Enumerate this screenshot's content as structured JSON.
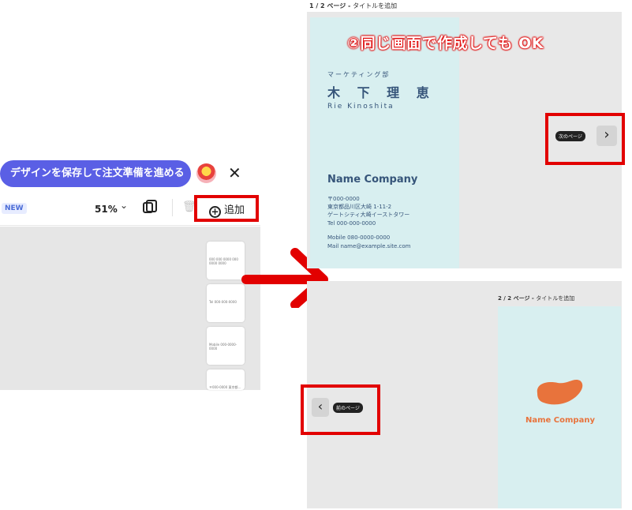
{
  "editor": {
    "save_button": "デザインを保存して注文準備を進める",
    "close": "✕",
    "new_badge": "NEW",
    "zoom": "51%",
    "zoom_chevron": "⌄",
    "trash": "🗑",
    "add_button": "追加",
    "add_icon": "+",
    "thumbs": [
      "000 000 0000 000 0000 0000",
      "Tel 000-000-0000",
      "Mobile 000-0000-0000",
      "〒000-0000 東京都..."
    ]
  },
  "annotation": {
    "headline": "②同じ画面で作成しても OK",
    "accent": "#e20000"
  },
  "page1": {
    "label_num": "1 / 2 ページ",
    "label_sep": " - ",
    "label_title": "タイトルを追加",
    "department": "マーケティング部",
    "name_jp": "木 下 理 恵",
    "name_en": "Rie Kinoshita",
    "company": "Name Company",
    "postal": "〒000-0000",
    "address1": "東京都品川区大崎 1-11-2",
    "address2": "ゲートシティ大崎イーストタワー",
    "tel": "Tel 000-000-0000",
    "mobile": "Mobile 080-0000-0000",
    "mail": "Mail name@example.site.com",
    "next_label": "次のページ",
    "next_icon": "›"
  },
  "page2": {
    "label_num": "2 / 2 ページ",
    "label_sep": " - ",
    "label_title": "タイトルを追加",
    "company": "Name Company",
    "prev_label": "前のページ",
    "prev_icon": "‹"
  }
}
